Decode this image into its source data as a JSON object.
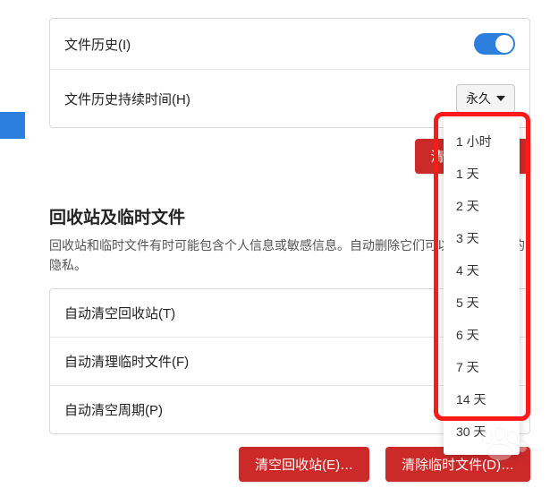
{
  "section1": {
    "file_history_label": "文件历史(I)",
    "file_history_on": true,
    "duration_label": "文件历史持续时间(H)",
    "duration_value": "永久",
    "clear_button": "清理历史(L)…"
  },
  "dropdown_options": [
    "1 小时",
    "1 天",
    "2 天",
    "3 天",
    "4 天",
    "5 天",
    "6 天",
    "7 天",
    "14 天",
    "30 天"
  ],
  "section2": {
    "title": "回收站及临时文件",
    "description": "回收站和临时文件有时可能包含个人信息或敏感信息。自动删除它们可以帮助保护您的隐私。",
    "auto_empty_trash_label": "自动清空回收站(T)",
    "auto_clear_temp_label": "自动清理临时文件(F)",
    "auto_period_label": "自动清空周期(P)",
    "empty_trash_button": "清空回收站(E)…",
    "clear_temp_button": "清除临时文件(D)…"
  }
}
